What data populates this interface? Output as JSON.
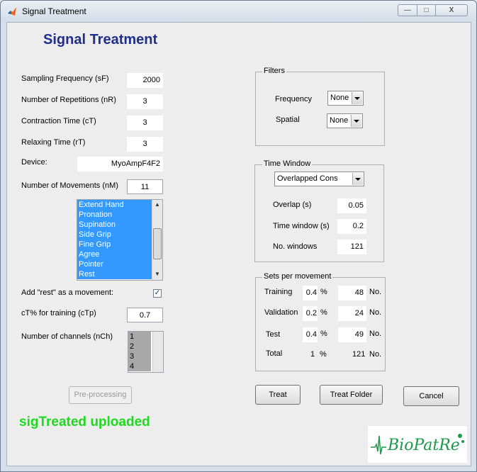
{
  "window": {
    "title": "Signal Treatment",
    "controls": {
      "minimize": "—",
      "maximize": "□",
      "close": "X"
    }
  },
  "heading": "Signal Treatment",
  "params": {
    "sampling_frequency": {
      "label": "Sampling Frequency (sF)",
      "value": "2000"
    },
    "repetitions": {
      "label": "Number of Repetitions  (nR)",
      "value": "3"
    },
    "contraction_time": {
      "label": "Contraction Time  (cT)",
      "value": "3"
    },
    "relaxing_time": {
      "label": "Relaxing Time  (rT)",
      "value": "3"
    },
    "device": {
      "label": "Device:",
      "value": "MyoAmpF4F2"
    },
    "movements": {
      "label": "Number of Movements (nM)",
      "value": "11"
    }
  },
  "movement_list": [
    "Extend Hand",
    "Pronation",
    "Supination",
    "Side Grip",
    "Fine Grip",
    "Agree",
    "Pointer",
    "Rest"
  ],
  "add_rest": {
    "label": "Add \"rest\" as a movement:",
    "checked": true,
    "mark": "✓"
  },
  "ct_training": {
    "label": "cT% for training   (cTp)",
    "value": "0.7"
  },
  "channels": {
    "label": "Number of channels (nCh)",
    "items": [
      "1",
      "2",
      "3",
      "4"
    ]
  },
  "preprocessing_button": "Pre-processing",
  "status_text": "sigTreated uploaded",
  "filters": {
    "title": "Filters",
    "frequency": {
      "label": "Frequency",
      "value": "None"
    },
    "spatial": {
      "label": "Spatial",
      "value": "None"
    }
  },
  "time_window": {
    "title": "Time Window",
    "mode": "Overlapped Cons",
    "overlap": {
      "label": "Overlap (s)",
      "value": "0.05"
    },
    "window": {
      "label": "Time window  (s)",
      "value": "0.2"
    },
    "count": {
      "label": "No. windows",
      "value": "121"
    }
  },
  "sets": {
    "title": "Sets per movement",
    "training": {
      "label": "Training",
      "pct": "0.4",
      "no": "48"
    },
    "validation": {
      "label": "Validation",
      "pct": "0.2",
      "no": "24"
    },
    "test": {
      "label": "Test",
      "pct": "0.4",
      "no": "49"
    },
    "total": {
      "label": "Total",
      "pct": "1",
      "no": "121"
    },
    "pct_symbol": "%",
    "no_label": "No."
  },
  "buttons": {
    "treat": "Treat",
    "treat_folder": "Treat Folder",
    "cancel": "Cancel"
  },
  "logo_text": "BioPatRe"
}
